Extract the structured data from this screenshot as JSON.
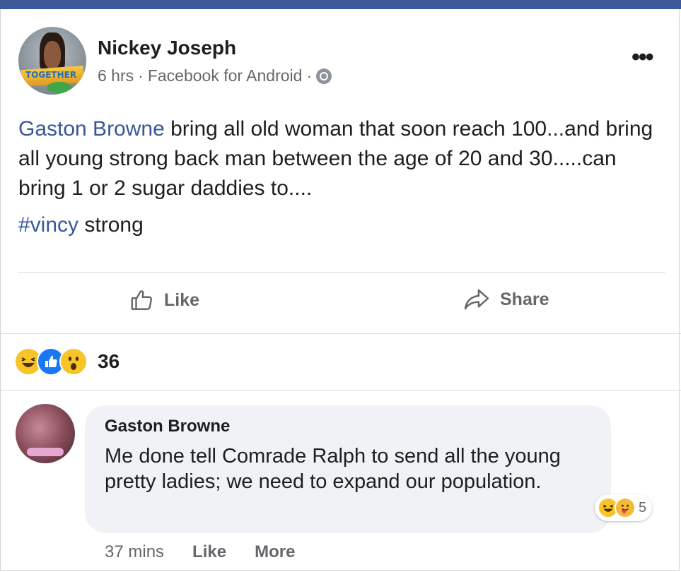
{
  "post": {
    "author": "Nickey Joseph",
    "avatar_banner": "TOGETHER",
    "time": "6 hrs",
    "separator": "·",
    "source": "Facebook for Android",
    "separator2": "·",
    "privacy_icon": "globe-icon",
    "menu_icon": "more-dots-icon",
    "mention": "Gaston Browne",
    "text": " bring all old woman that soon reach 100...and bring all young strong back man between the age of 20 and 30.....can bring 1 or 2 sugar daddies to....",
    "hashtag": "#vincy",
    "hashtag_suffix": " strong"
  },
  "actions": {
    "like_label": "Like",
    "share_label": "Share"
  },
  "reactions": {
    "icons": [
      "haha-reaction-icon",
      "like-reaction-icon",
      "wow-reaction-icon"
    ],
    "count": "36"
  },
  "comment": {
    "author": "Gaston Browne",
    "text": "Me done tell Comrade Ralph to send all the young pretty ladies; we need to expand our population.",
    "reaction_icons": [
      "haha-reaction-icon",
      "care-reaction-icon"
    ],
    "reaction_count": "5",
    "time": "37 mins",
    "like_label": "Like",
    "more_label": "More"
  },
  "colors": {
    "brand_blue": "#3b5998",
    "link_blue": "#385898",
    "muted_gray": "#65676b",
    "bubble_gray": "#f0f2f5",
    "like_blue": "#1877f2",
    "emoji_yellow": "#f7c42a"
  }
}
